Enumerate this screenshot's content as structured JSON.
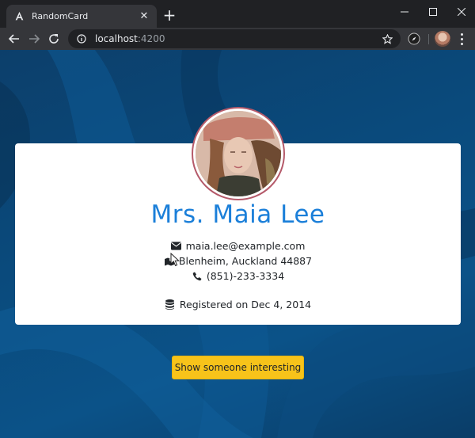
{
  "browser": {
    "tab_title": "RandomCard",
    "tab_close": "✕",
    "new_tab": "+",
    "url_host": "localhost",
    "url_port": ":4200"
  },
  "card": {
    "name": "Mrs. Maia  Lee",
    "email": "maia.lee@example.com",
    "address": "Blenheim, Auckland 44887",
    "phone": "(851)-233-3334",
    "registered": "Registered on Dec 4, 2014"
  },
  "button": {
    "label": "Show someone interesting"
  },
  "icons": {
    "email": "envelope-icon",
    "address": "map-marker-icon",
    "phone": "phone-icon",
    "registered": "database-icon"
  },
  "colors": {
    "name": "#1b7fd9",
    "button": "#f7c31a",
    "avatar_border": "#b55a6a"
  }
}
